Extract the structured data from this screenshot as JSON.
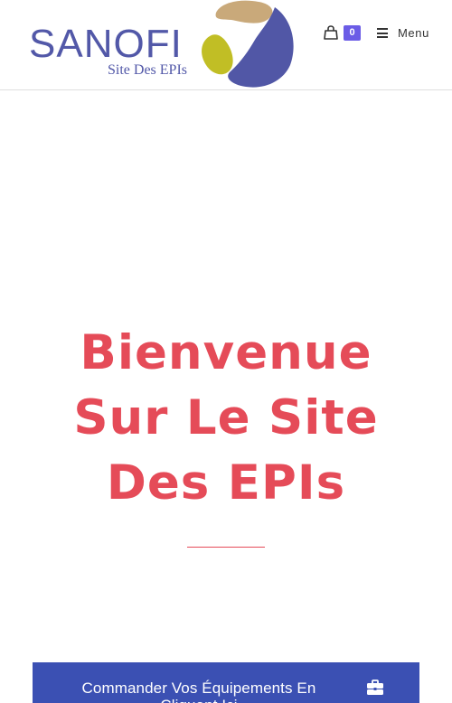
{
  "header": {
    "logo": {
      "wordmark": "SANOFI",
      "subtitle": "Site Des EPIs",
      "icon": "sanofi-swirl-logo",
      "colors": {
        "wordmark": "#5258a8",
        "gold": "#c9a97a",
        "lime": "#c1be25",
        "indigo": "#5157a6"
      }
    },
    "cart": {
      "icon": "shopping-bag-icon",
      "count": "0",
      "badge_color": "#6b5ce6"
    },
    "menu": {
      "icon": "hamburger-icon",
      "label": "Menu"
    }
  },
  "hero": {
    "title_lines": [
      "Bienvenue",
      "Sur Le Site",
      "Des EPIs"
    ],
    "title_color": "#e54b58",
    "divider_color": "#e54b58"
  },
  "order_button": {
    "label": "Commander Vos Équipements En Cliquant Ici",
    "icon": "briefcase-icon",
    "background": "#3b50b3"
  }
}
